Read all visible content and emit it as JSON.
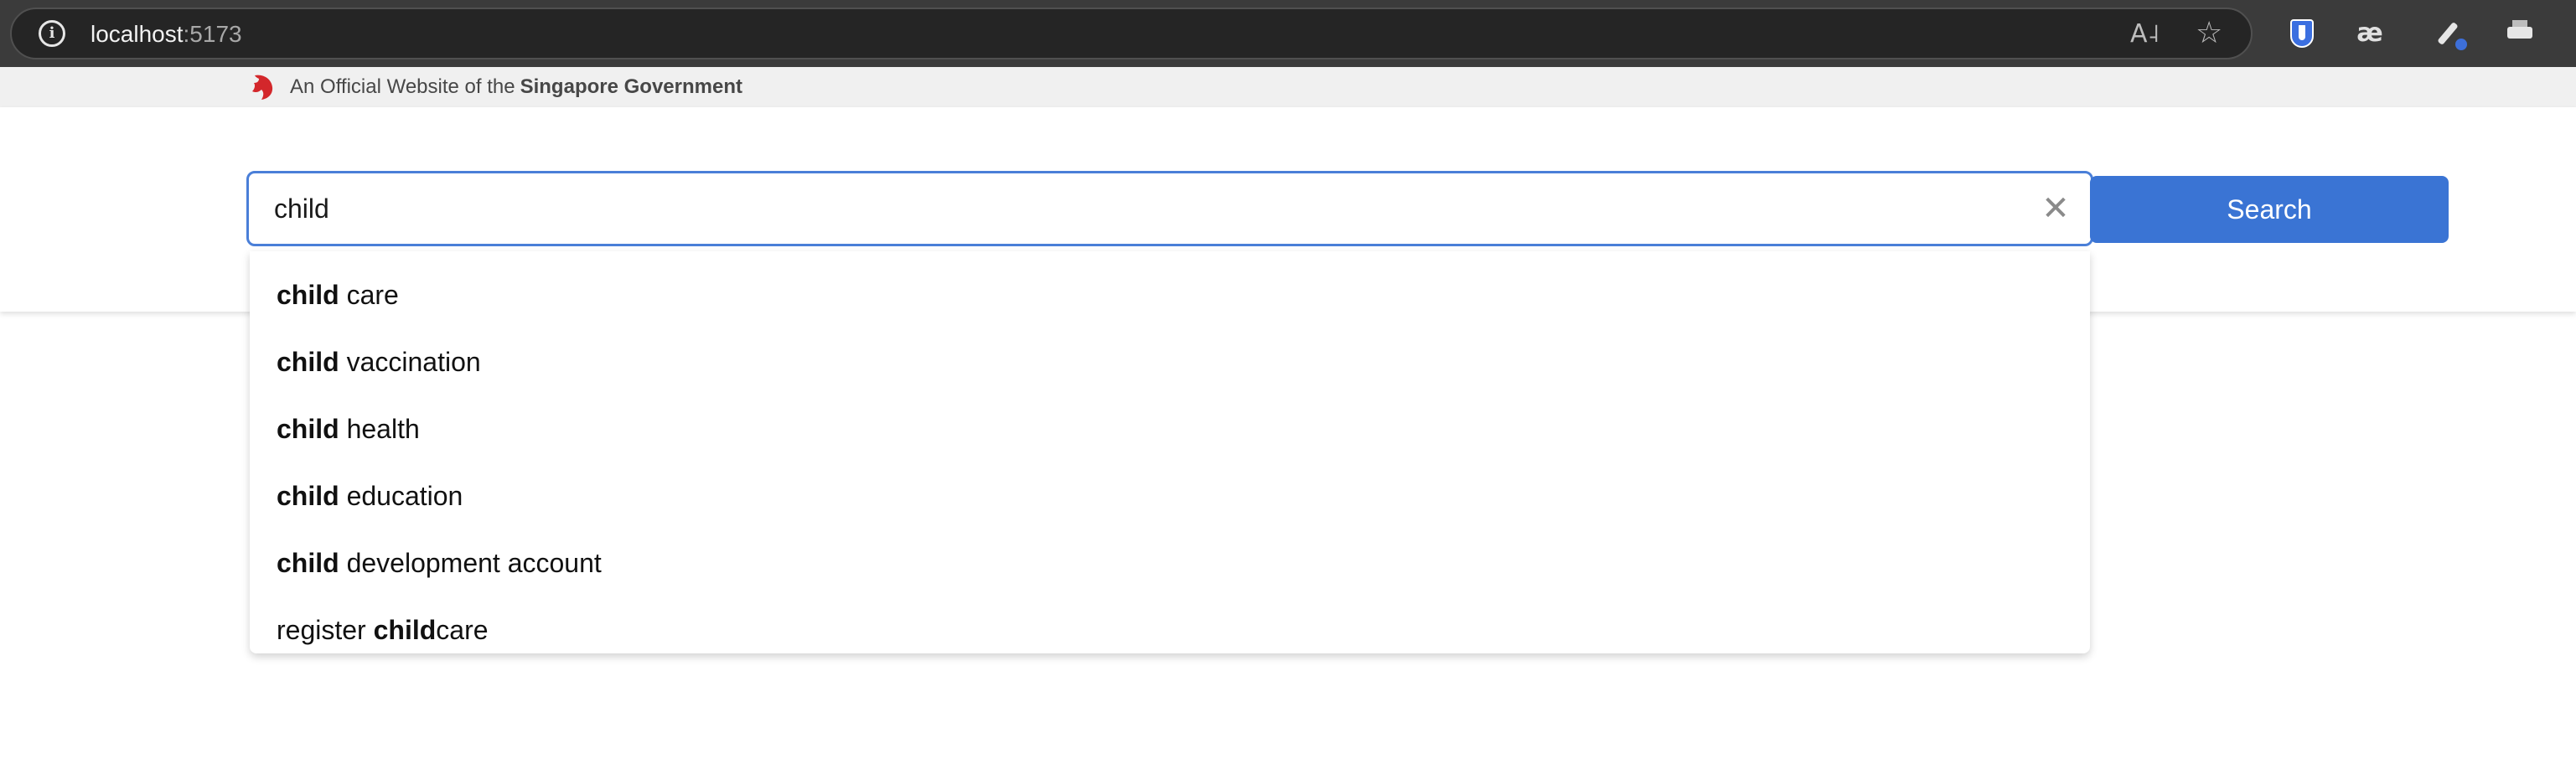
{
  "browser": {
    "url_host": "localhost",
    "url_port": ":5173",
    "icons": [
      "info-icon",
      "read-aloud-icon",
      "star-icon",
      "bitwarden-icon",
      "ae-icon",
      "eyedropper-icon",
      "printer-icon"
    ]
  },
  "masthead": {
    "prefix": "An Official Website of the",
    "strong": "Singapore Government",
    "icon": "lion-head-icon"
  },
  "search": {
    "value": "child",
    "placeholder": "",
    "button_label": "Search",
    "clear_icon": "close-icon"
  },
  "suggestions": [
    {
      "before": "",
      "match": "child",
      "after": " care"
    },
    {
      "before": "",
      "match": "child",
      "after": " vaccination"
    },
    {
      "before": "",
      "match": "child",
      "after": " health"
    },
    {
      "before": "",
      "match": "child",
      "after": " education"
    },
    {
      "before": "",
      "match": "child",
      "after": " development account"
    },
    {
      "before": "register ",
      "match": "child",
      "after": "care"
    }
  ],
  "colors": {
    "accent": "#3a74d4",
    "focus_border": "#4a7fd8",
    "masthead_bg": "#f0f0f0",
    "lion_red": "#d3272b"
  }
}
